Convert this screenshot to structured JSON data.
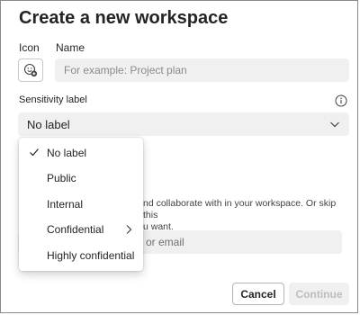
{
  "dialog": {
    "title": "Create a new workspace",
    "icon_label": "Icon",
    "name_label": "Name",
    "name_placeholder": "For example: Project plan",
    "name_value": "",
    "sensitivity_label": "Sensitivity label",
    "sensitivity_selected": "No label",
    "members_text": "nd collaborate with in your workspace. Or skip this u want.",
    "members_placeholder": "or email",
    "buttons": {
      "cancel": "Cancel",
      "continue": "Continue"
    }
  },
  "dropdown": {
    "items": [
      {
        "label": "No label",
        "checked": true
      },
      {
        "label": "Public"
      },
      {
        "label": "Internal"
      },
      {
        "label": "Confidential",
        "has_submenu": true
      },
      {
        "label": "Highly confidential"
      }
    ]
  },
  "colors": {
    "input_bg": "#f0f0f0",
    "text": "#242424",
    "disabled_text": "#bdbdbd"
  }
}
